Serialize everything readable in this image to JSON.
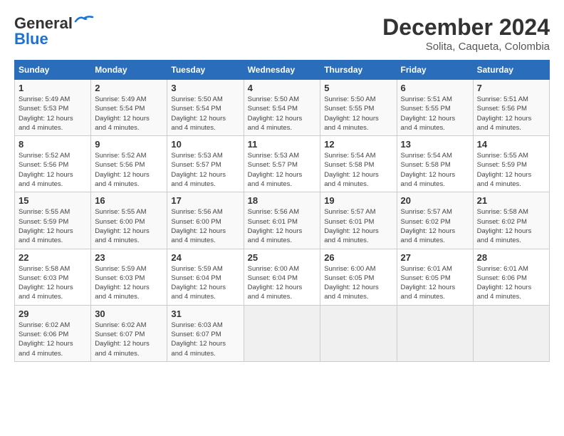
{
  "header": {
    "logo_general": "General",
    "logo_blue": "Blue",
    "month": "December 2024",
    "location": "Solita, Caqueta, Colombia"
  },
  "days_of_week": [
    "Sunday",
    "Monday",
    "Tuesday",
    "Wednesday",
    "Thursday",
    "Friday",
    "Saturday"
  ],
  "weeks": [
    [
      {
        "day": 1,
        "info": "Sunrise: 5:49 AM\nSunset: 5:53 PM\nDaylight: 12 hours\nand 4 minutes."
      },
      {
        "day": 2,
        "info": "Sunrise: 5:49 AM\nSunset: 5:54 PM\nDaylight: 12 hours\nand 4 minutes."
      },
      {
        "day": 3,
        "info": "Sunrise: 5:50 AM\nSunset: 5:54 PM\nDaylight: 12 hours\nand 4 minutes."
      },
      {
        "day": 4,
        "info": "Sunrise: 5:50 AM\nSunset: 5:54 PM\nDaylight: 12 hours\nand 4 minutes."
      },
      {
        "day": 5,
        "info": "Sunrise: 5:50 AM\nSunset: 5:55 PM\nDaylight: 12 hours\nand 4 minutes."
      },
      {
        "day": 6,
        "info": "Sunrise: 5:51 AM\nSunset: 5:55 PM\nDaylight: 12 hours\nand 4 minutes."
      },
      {
        "day": 7,
        "info": "Sunrise: 5:51 AM\nSunset: 5:56 PM\nDaylight: 12 hours\nand 4 minutes."
      }
    ],
    [
      {
        "day": 8,
        "info": "Sunrise: 5:52 AM\nSunset: 5:56 PM\nDaylight: 12 hours\nand 4 minutes."
      },
      {
        "day": 9,
        "info": "Sunrise: 5:52 AM\nSunset: 5:56 PM\nDaylight: 12 hours\nand 4 minutes."
      },
      {
        "day": 10,
        "info": "Sunrise: 5:53 AM\nSunset: 5:57 PM\nDaylight: 12 hours\nand 4 minutes."
      },
      {
        "day": 11,
        "info": "Sunrise: 5:53 AM\nSunset: 5:57 PM\nDaylight: 12 hours\nand 4 minutes."
      },
      {
        "day": 12,
        "info": "Sunrise: 5:54 AM\nSunset: 5:58 PM\nDaylight: 12 hours\nand 4 minutes."
      },
      {
        "day": 13,
        "info": "Sunrise: 5:54 AM\nSunset: 5:58 PM\nDaylight: 12 hours\nand 4 minutes."
      },
      {
        "day": 14,
        "info": "Sunrise: 5:55 AM\nSunset: 5:59 PM\nDaylight: 12 hours\nand 4 minutes."
      }
    ],
    [
      {
        "day": 15,
        "info": "Sunrise: 5:55 AM\nSunset: 5:59 PM\nDaylight: 12 hours\nand 4 minutes."
      },
      {
        "day": 16,
        "info": "Sunrise: 5:55 AM\nSunset: 6:00 PM\nDaylight: 12 hours\nand 4 minutes."
      },
      {
        "day": 17,
        "info": "Sunrise: 5:56 AM\nSunset: 6:00 PM\nDaylight: 12 hours\nand 4 minutes."
      },
      {
        "day": 18,
        "info": "Sunrise: 5:56 AM\nSunset: 6:01 PM\nDaylight: 12 hours\nand 4 minutes."
      },
      {
        "day": 19,
        "info": "Sunrise: 5:57 AM\nSunset: 6:01 PM\nDaylight: 12 hours\nand 4 minutes."
      },
      {
        "day": 20,
        "info": "Sunrise: 5:57 AM\nSunset: 6:02 PM\nDaylight: 12 hours\nand 4 minutes."
      },
      {
        "day": 21,
        "info": "Sunrise: 5:58 AM\nSunset: 6:02 PM\nDaylight: 12 hours\nand 4 minutes."
      }
    ],
    [
      {
        "day": 22,
        "info": "Sunrise: 5:58 AM\nSunset: 6:03 PM\nDaylight: 12 hours\nand 4 minutes."
      },
      {
        "day": 23,
        "info": "Sunrise: 5:59 AM\nSunset: 6:03 PM\nDaylight: 12 hours\nand 4 minutes."
      },
      {
        "day": 24,
        "info": "Sunrise: 5:59 AM\nSunset: 6:04 PM\nDaylight: 12 hours\nand 4 minutes."
      },
      {
        "day": 25,
        "info": "Sunrise: 6:00 AM\nSunset: 6:04 PM\nDaylight: 12 hours\nand 4 minutes."
      },
      {
        "day": 26,
        "info": "Sunrise: 6:00 AM\nSunset: 6:05 PM\nDaylight: 12 hours\nand 4 minutes."
      },
      {
        "day": 27,
        "info": "Sunrise: 6:01 AM\nSunset: 6:05 PM\nDaylight: 12 hours\nand 4 minutes."
      },
      {
        "day": 28,
        "info": "Sunrise: 6:01 AM\nSunset: 6:06 PM\nDaylight: 12 hours\nand 4 minutes."
      }
    ],
    [
      {
        "day": 29,
        "info": "Sunrise: 6:02 AM\nSunset: 6:06 PM\nDaylight: 12 hours\nand 4 minutes."
      },
      {
        "day": 30,
        "info": "Sunrise: 6:02 AM\nSunset: 6:07 PM\nDaylight: 12 hours\nand 4 minutes."
      },
      {
        "day": 31,
        "info": "Sunrise: 6:03 AM\nSunset: 6:07 PM\nDaylight: 12 hours\nand 4 minutes."
      },
      null,
      null,
      null,
      null
    ]
  ]
}
